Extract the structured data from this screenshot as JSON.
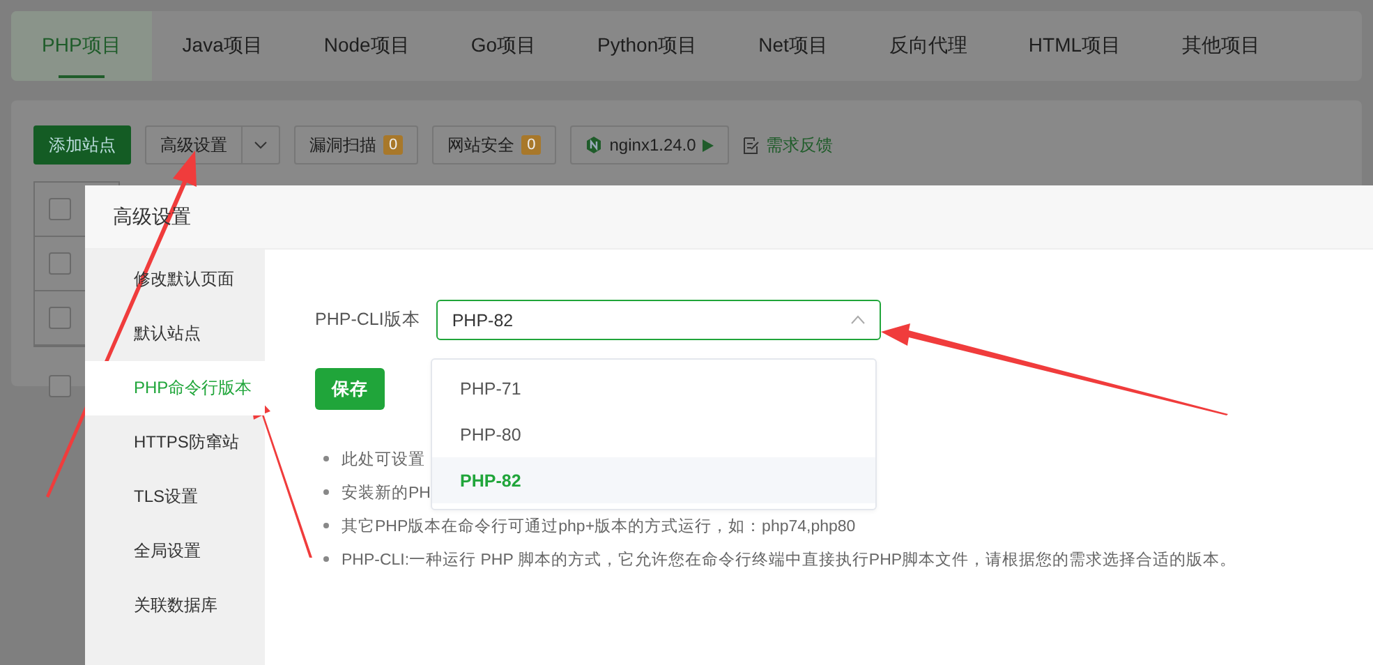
{
  "tabs": [
    {
      "label": "PHP项目",
      "selected": true
    },
    {
      "label": "Java项目",
      "selected": false
    },
    {
      "label": "Node项目",
      "selected": false
    },
    {
      "label": "Go项目",
      "selected": false
    },
    {
      "label": "Python项目",
      "selected": false
    },
    {
      "label": "Net项目",
      "selected": false
    },
    {
      "label": "反向代理",
      "selected": false
    },
    {
      "label": "HTML项目",
      "selected": false
    },
    {
      "label": "其他项目",
      "selected": false
    }
  ],
  "toolbar": {
    "add_site": "添加站点",
    "advanced": "高级设置",
    "vuln_scan": {
      "label": "漏洞扫描",
      "count": "0"
    },
    "site_security": {
      "label": "网站安全",
      "count": "0"
    },
    "nginx": "nginx1.24.0",
    "feedback": "需求反馈"
  },
  "table": {
    "rows": [
      {
        "checked": false
      },
      {
        "checked": false
      },
      {
        "checked": false
      }
    ],
    "footer_checked": false
  },
  "dialog": {
    "title": "高级设置",
    "menu": [
      {
        "label": "修改默认页面",
        "selected": false
      },
      {
        "label": "默认站点",
        "selected": false
      },
      {
        "label": "PHP命令行版本",
        "selected": true
      },
      {
        "label": "HTTPS防窜站",
        "selected": false
      },
      {
        "label": "TLS设置",
        "selected": false
      },
      {
        "label": "全局设置",
        "selected": false
      },
      {
        "label": "关联数据库",
        "selected": false
      }
    ],
    "form": {
      "label": "PHP-CLI版本",
      "value": "PHP-82",
      "expanded": true,
      "options": [
        {
          "label": "PHP-71",
          "selected": false
        },
        {
          "label": "PHP-80",
          "selected": false
        },
        {
          "label": "PHP-82",
          "selected": true
        }
      ],
      "save": "保存"
    },
    "notes": [
      "此处可设置",
      "安装新的PH",
      "其它PHP版本在命令行可通过php+版本的方式运行，如：php74,php80",
      "PHP-CLI:一种运行 PHP 脚本的方式，它允许您在命令行终端中直接执行PHP脚本文件，请根据您的需求选择合适的版本。"
    ]
  }
}
